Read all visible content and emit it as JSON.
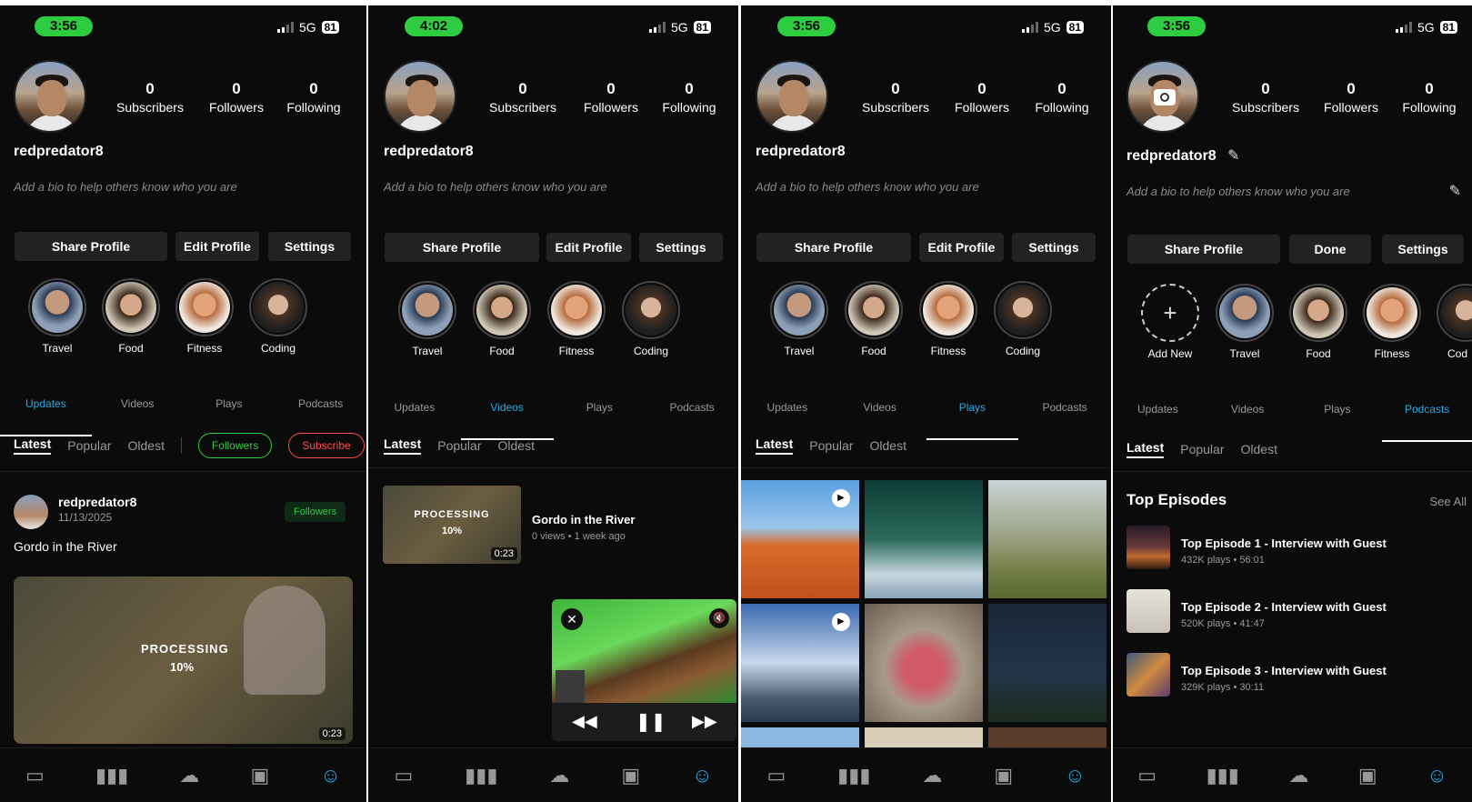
{
  "status": {
    "time1": "3:56",
    "time2": "4:02",
    "time3": "3:56",
    "time4": "3:56",
    "network": "5G",
    "battery": "81"
  },
  "profile": {
    "username": "redpredator8",
    "bio_placeholder": "Add a bio to help others know who you are",
    "stats": {
      "subscribers": "0",
      "subscribers_label": "Subscribers",
      "followers": "0",
      "followers_label": "Followers",
      "following": "0",
      "following_label": "Following"
    }
  },
  "buttons": {
    "share": "Share Profile",
    "edit": "Edit Profile",
    "done": "Done",
    "settings": "Settings"
  },
  "highlights": {
    "travel": "Travel",
    "food": "Food",
    "fitness": "Fitness",
    "coding": "Coding",
    "add_new": "Add New",
    "cod_partial": "Cod"
  },
  "tabs": {
    "updates": "Updates",
    "videos": "Videos",
    "plays": "Plays",
    "podcasts": "Podcasts"
  },
  "sort": {
    "latest": "Latest",
    "popular": "Popular",
    "oldest": "Oldest"
  },
  "filters": {
    "followers": "Followers",
    "subscribe": "Subscribe"
  },
  "post": {
    "author": "redpredator8",
    "date": "11/13/2025",
    "badge": "Followers",
    "text": "Gordo in the River",
    "processing": "PROCESSING",
    "progress": "10%",
    "duration": "0:23"
  },
  "video": {
    "title": "Gordo in the River",
    "meta": "0 views • 1 week ago",
    "processing": "PROCESSING",
    "progress": "10%",
    "duration": "0:23"
  },
  "podcasts": {
    "section_title": "Top Episodes",
    "see_all": "See All",
    "episodes": [
      {
        "title": "Top Episode 1 - Interview with Guest",
        "meta": "432K plays • 56:01"
      },
      {
        "title": "Top Episode 2 - Interview with Guest",
        "meta": "520K plays • 41:47"
      },
      {
        "title": "Top Episode 3 - Interview with Guest",
        "meta": "329K plays • 30:11"
      }
    ]
  },
  "icons": {
    "accent": "#29a9e0",
    "green": "#2ecc40"
  }
}
